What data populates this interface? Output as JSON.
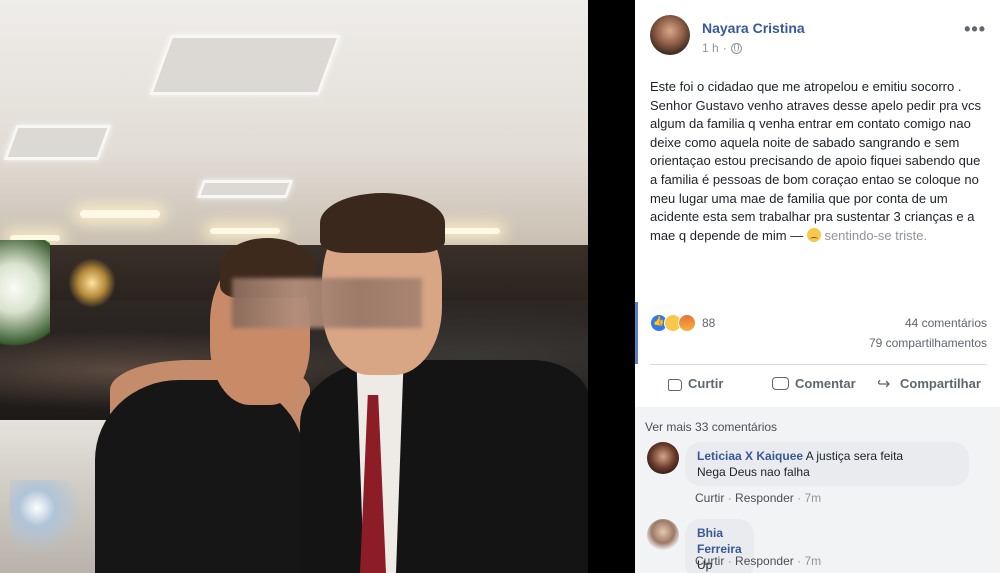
{
  "post": {
    "author": "Nayara Cristina",
    "time": "1 h",
    "more_label": "•••",
    "text": "Este foi o cidadao que me atropelou e emitiu socorro . Senhor Gustavo venho atraves desse apelo pedir pra vcs algum da familia q venha entrar em contato comigo nao deixe como aquela noite de sabado sangrando e sem orientaçao estou precisando de apoio fiquei sabendo que a familia é pessoas de bom coraçao entao se coloque no meu lugar uma mae de familia que por conta de um acidente esta sem trabalhar pra sustentar 3 crianças e a mae q depende de mim —",
    "feeling": "sentindo-se triste."
  },
  "stats": {
    "reaction_count": "88",
    "comments": "44 comentários",
    "shares": "79 compartilhamentos"
  },
  "actions": {
    "like": "Curtir",
    "comment": "Comentar",
    "share": "Compartilhar"
  },
  "comments_section": {
    "view_more": "Ver mais 33 comentários",
    "items": [
      {
        "author": "Leticiaa X Kaiquee",
        "text_line1": "A justiça sera feita",
        "text_line2": "Nega Deus nao falha",
        "like": "Curtir",
        "reply": "Responder",
        "time": "7m"
      },
      {
        "author": "Bhia Ferreira",
        "text_line1": "Up",
        "like": "Curtir",
        "reply": "Responder",
        "time": "7m"
      }
    ]
  },
  "colors": {
    "link_blue": "#385898",
    "text_dark": "#1d2129",
    "text_gray": "#606770",
    "accent_line": "#5b7fc9"
  }
}
